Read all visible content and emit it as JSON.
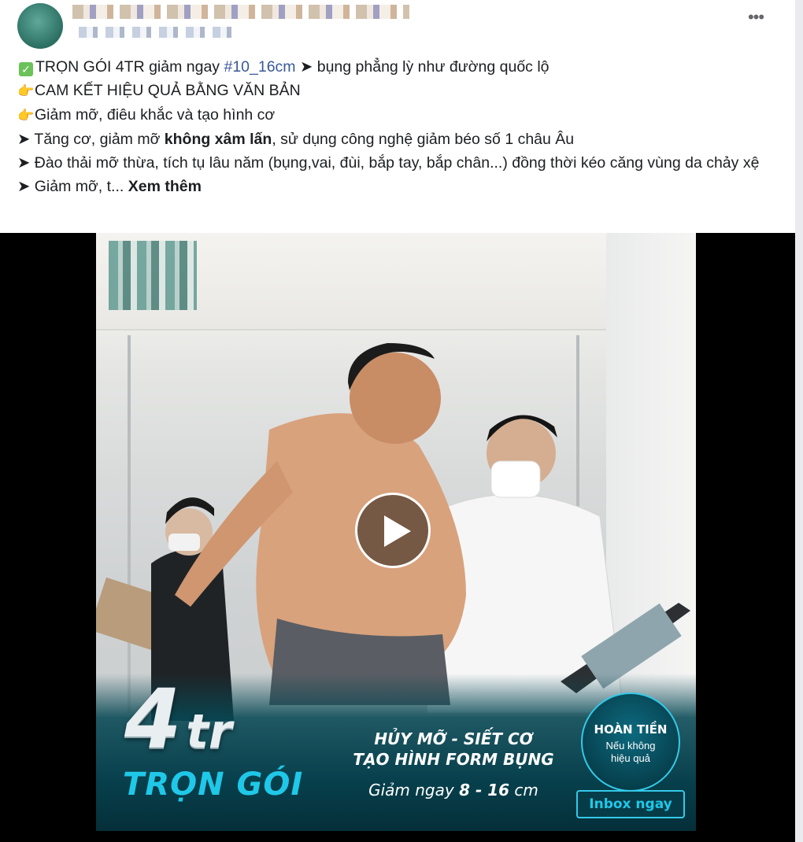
{
  "post": {
    "author_name": "",
    "more_icon": "ellipsis-icon",
    "more_label": "•••",
    "lines": {
      "l1_a": "TRỌN GÓI 4TR giảm ngay ",
      "l1_hashtag": "#10_16cm",
      "l1_b": " ➤ bụng phẳng lỳ như đường quốc lộ",
      "l2": "CAM KẾT HIỆU QUẢ BẰNG VĂN BẢN",
      "l3": "Giảm mỡ, điêu khắc và tạo hình cơ",
      "l4_a": "➤ Tăng cơ, giảm mỡ ",
      "l4_bold": "không xâm lấn",
      "l4_b": ", sử dụng công nghệ giảm béo số 1 châu Âu",
      "l5": "➤ Đào thải mỡ thừa, tích tụ lâu năm (bụng,vai, đùi, bắp tay, bắp chân...) đồng thời kéo căng vùng da chảy xệ",
      "l6_a": "➤ Giảm mỡ, t... ",
      "see_more": "Xem thêm"
    },
    "icons": {
      "check": "check-mark-icon",
      "point": "pointing-hand-icon"
    }
  },
  "video": {
    "play_icon": "play-icon",
    "banner": {
      "price_big": "4",
      "price_unit": "tr",
      "package": "TRỌN GÓI",
      "tagline_1": "HỦY MỠ - SIẾT CƠ",
      "tagline_2": "TẠO HÌNH FORM BỤNG",
      "offer_prefix": "Giảm ngay ",
      "offer_value": "8 - 16",
      "offer_unit": " cm",
      "badge_title": "HOÀN TIỀN",
      "badge_sub": "Nếu không hiệu quả",
      "cta": "Inbox ngay"
    }
  },
  "colors": {
    "hashtag": "#385898",
    "banner_dark": "#063f4b",
    "accent_cyan": "#1fc8e8"
  }
}
